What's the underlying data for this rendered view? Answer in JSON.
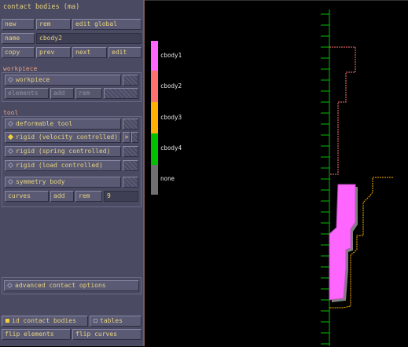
{
  "panel": {
    "title": "contact bodies (ma)",
    "row1": {
      "new": "new",
      "rem": "rem",
      "edit_global": "edit global"
    },
    "name_label": "name",
    "name_value": "cbody2",
    "row3": {
      "copy": "copy",
      "prev": "prev",
      "next": "next",
      "edit": "edit"
    },
    "workpiece_header": "workpiece",
    "workpiece_option": "workpiece",
    "workpiece_row": {
      "elements": "elements",
      "add": "add",
      "rem": "rem"
    },
    "tool_header": "tool",
    "tool_options": [
      {
        "label": "deformable tool",
        "selected": false
      },
      {
        "label": "rigid (velocity controlled)",
        "selected": true,
        "side": ">"
      },
      {
        "label": "rigid (spring controlled)",
        "selected": false
      },
      {
        "label": "rigid (load controlled)",
        "selected": false
      }
    ],
    "symmetry_option": "symmetry body",
    "curves_row": {
      "curves": "curves",
      "add": "add",
      "rem": "rem",
      "count": "9"
    },
    "advanced_button": "advanced contact options",
    "id_contact_bodies": "id contact bodies",
    "tables": "tables",
    "flip_elements": "flip elements",
    "flip_curves": "flip curves"
  },
  "legend": [
    {
      "label": "cbody1",
      "color": "#ff66ff"
    },
    {
      "label": "cbody2",
      "color": "#ff7070"
    },
    {
      "label": "cbody3",
      "color": "#ffb000"
    },
    {
      "label": "cbody4",
      "color": "#00c000"
    },
    {
      "label": "none",
      "color": "#707070"
    }
  ],
  "colors": {
    "axis": "#00c000",
    "cbody1": "#ff66ff",
    "cbody2": "#ff7070",
    "cbody3": "#ffb000",
    "panel_text": "#e6d280"
  }
}
